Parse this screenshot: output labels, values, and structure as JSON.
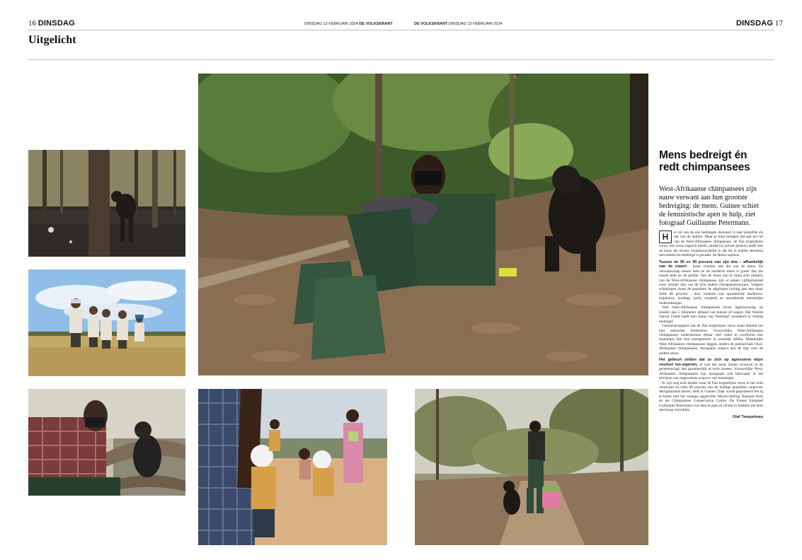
{
  "header": {
    "left_page_number": "16",
    "left_day": "DINSDAG",
    "left_folio_date": "DINSDAG 13 FEBRUARI 2024",
    "left_folio_paper": "DE VOLKSKRANT",
    "right_folio_paper": "DE VOLKSKRANT",
    "right_folio_date": "DINSDAG 13 FEBRUARI 2024",
    "right_day": "DINSDAG",
    "right_page_number": "17"
  },
  "section_title": "Uitgelicht",
  "article": {
    "headline_line1": "Mens bedreigt én",
    "headline_line2": "redt chimpansees",
    "intro": "West-Afrikaanse chimpansees zijn nauw verwant aan hun grootste bedreiging: de mens. Guinee schiet de feministische apen te hulp, ziet fotograaf Guillaume Petermann.",
    "dropcap": "H",
    "para1": "et lot van de ene bedreigde diersoort is niet hetzelfde als dat van de andere. Maar je kunt betogen dat aan het lot van de West-Afrikaanse chimpansee, de Pan troglodytes verus, iets extra tragisch kleeft, omdat hij zoveel gemeen heeft met de soort die ervoor verantwoordelijk is dat hij in enkele decennia met uitsterven bedreigd is geraakt: de Homo sapiens.",
    "lead2": "Tussen de 95 en 99 procent van zijn dna – afhankelijk van de expert",
    "para2": " - komt overeen met dat van de mens. De verwantschap tussen hem en de moderne mens is groter dan die tussen hem en de gorilla. Van de mens zijn er bijna acht miljard, van de West-Afrikaanse chimpansee zijn er amper vijftigduizend over, minder dan van de drie andere chimpansee­soorten. Volgens schattingen slonk de populatie de afgelopen twintig jaar met maar liefst 80 procent - door toedoen van oprukkende landbouw, mijnbouw, houtkap, jacht, stroperij en oprukkende menselijke nederzettingen.",
    "para3": "Veel West-Afrikaanse chimpansees leven tegenwoordig op minder dan 5 kilometer afstand van huizen of wegen. Het Wereld Natuur Fonds heeft hun status van 'bedreigd' veranderd in 'ernstig bedreigd'.",
    "para4": "Gemeenschappen van de Pan troglodytes verus staan bekend om hun natuurlijk feminisme: Vrouwelijke West-Afrikaanse chimpansees ondersteunen elkaar veel vaker in conflicten met mannetjes dan hun soortgenoten in oostelijk Afrika. Mannelijke West-Afrikaanse chimpansees leggen, anders de patriarchale Oost-Afrikaanse chimpansees, doorgaans respect aan de dag voor de andere sekse.",
    "lead5": "Het gebeurt zelden dat ze zich op agressieve wijze voedsel toe-eigenen,",
    "para5": " al was het maar omdat vrouwen in de gemeenschap dan gezamenlijk in actie komen. Vrouwelijke West-Afrikaanse chimpansees zijn doorgaans ook bekwaam in het afwijzen van ongewenste avances van mannetjes.",
    "para6": "Er zijn nog acht landen waar de Pan troglodytes verus in het wild voorkomt en ruim 60 procent van de huidige populatie, ongeveer dertigduizend dieren, leeft in Guinee. Daar wordt geprobeerd het tij te keren met het onlangs opgerichte Moyen-Bafing National Park en het Chimpanzee Conservation Centre. De Franse fotograaf Guillaume Petermann was daar te gast en schoot er beelden die hem met hoop vervulden.",
    "byline": "Olaf Tempelman"
  },
  "colors": {
    "rule": "#bdbdbd",
    "text": "#111111",
    "forest_dark": "#2b3320",
    "leaves": "#6b5a45",
    "sky": "#7fb2e0",
    "grass": "#b8a060",
    "sand": "#d7b487"
  },
  "photos": [
    {
      "name": "photo-burnt-forest-chimp"
    },
    {
      "name": "photo-rangers-savanna"
    },
    {
      "name": "photo-man-with-chimp"
    },
    {
      "name": "photo-main-ranger-chimp"
    },
    {
      "name": "photo-children-masks"
    },
    {
      "name": "photo-ranger-carrying-chimp"
    }
  ]
}
